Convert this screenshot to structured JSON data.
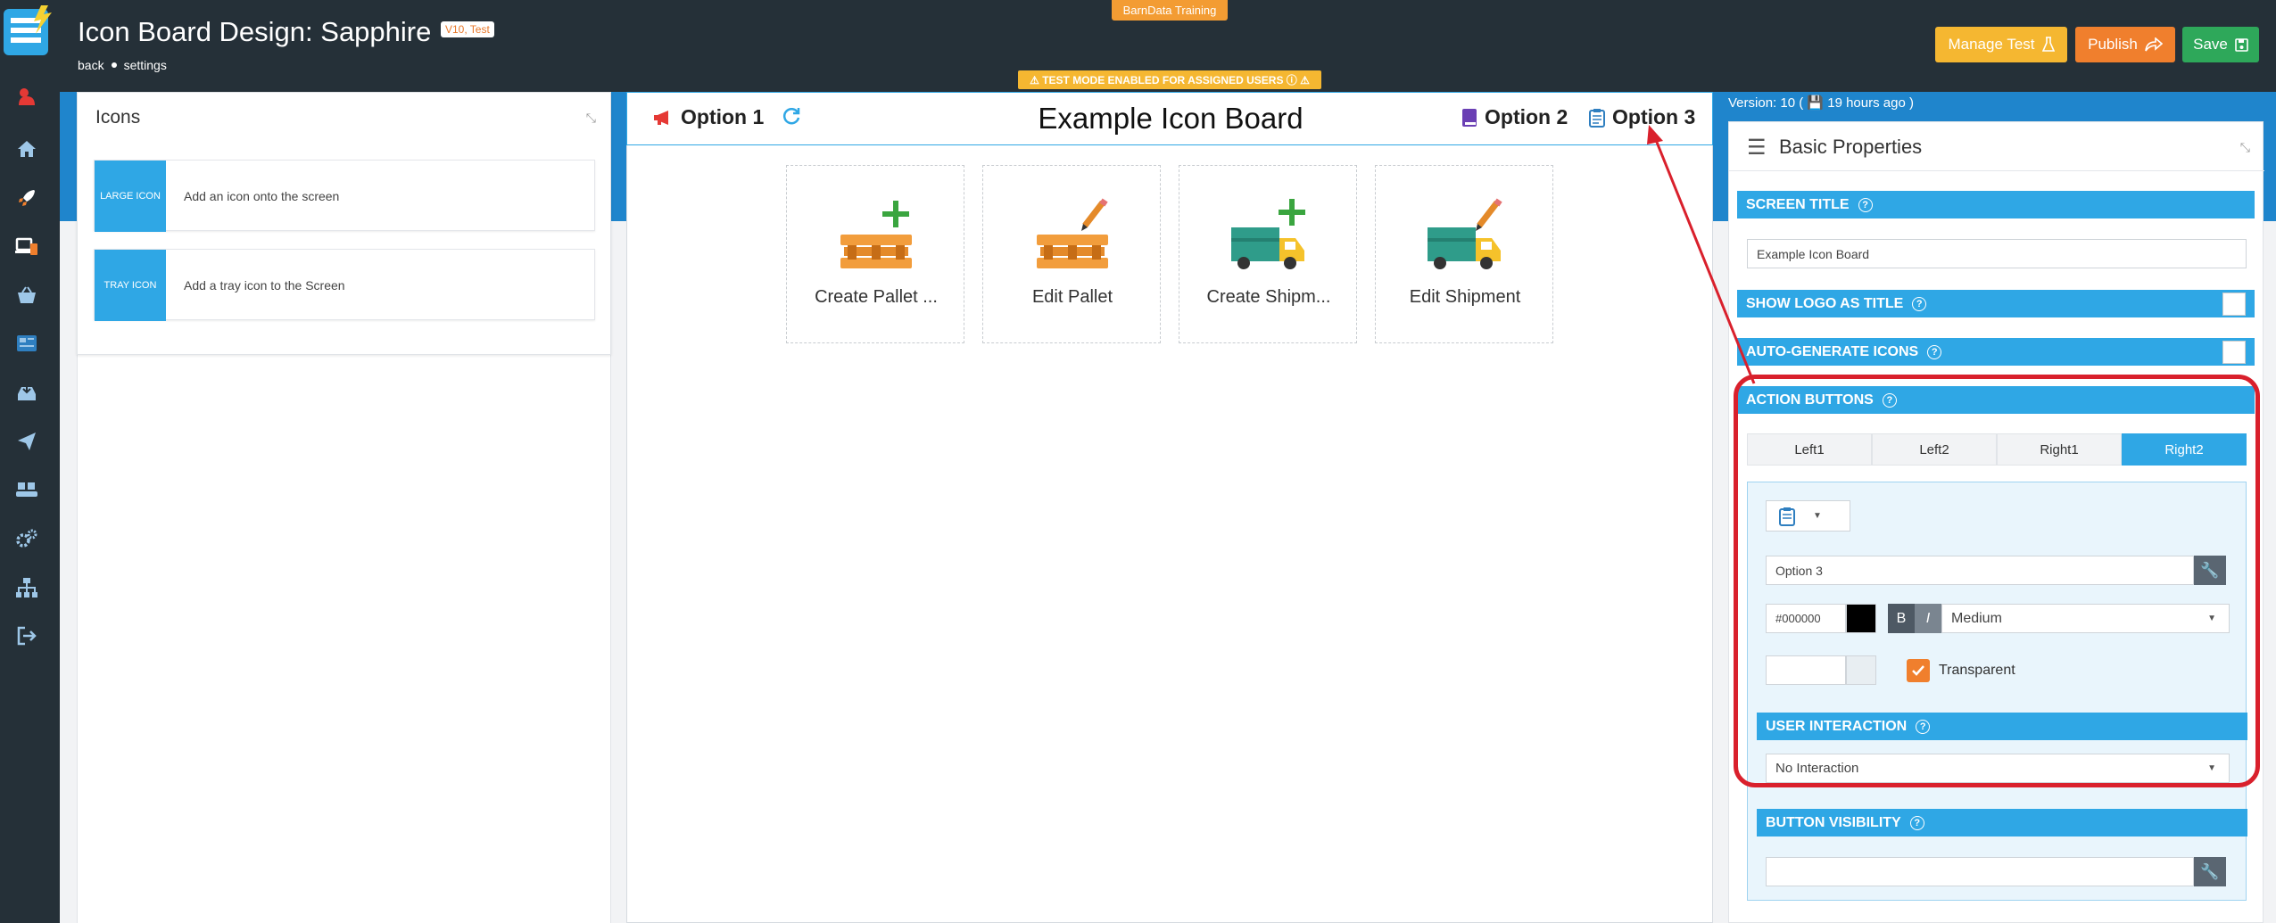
{
  "header": {
    "title": "Icon Board Design: Sapphire",
    "version_badge": "V10, Test",
    "back_link": "back",
    "settings_link": "settings",
    "org_badge": "BarnData Training",
    "test_banner": "⚠ TEST MODE ENABLED FOR ASSIGNED USERS ⓘ ⚠",
    "manage_test_label": "Manage Test",
    "publish_label": "Publish",
    "save_label": "Save"
  },
  "rail": {
    "icons": [
      "bell-icon",
      "home-icon",
      "rocket-icon",
      "devices-icon",
      "basket-icon",
      "dashboard-icon",
      "inbox-icon",
      "send-icon",
      "boxes-icon",
      "cogs-icon",
      "sitemap-icon",
      "logout-icon"
    ]
  },
  "palette": {
    "title": "Icons",
    "items": [
      {
        "swatch": "LARGE ICON",
        "description": "Add an icon onto the screen"
      },
      {
        "swatch": "TRAY ICON",
        "description": "Add a tray icon to the Screen"
      }
    ]
  },
  "board": {
    "screen_title": "Example Icon Board",
    "left_buttons": [
      {
        "label": "Option 1",
        "icon": "megaphone-icon"
      }
    ],
    "right_buttons": [
      {
        "label": "Option 2",
        "icon": "book-icon"
      },
      {
        "label": "Option 3",
        "icon": "clipboard-icon"
      }
    ],
    "tiles": [
      {
        "label": "Create Pallet ...",
        "icon": "pallet-add-icon"
      },
      {
        "label": "Edit Pallet",
        "icon": "pallet-edit-icon"
      },
      {
        "label": "Create Shipm...",
        "icon": "truck-add-icon"
      },
      {
        "label": "Edit Shipment",
        "icon": "truck-edit-icon"
      }
    ]
  },
  "properties": {
    "version_text": "Version: 10 ( 💾 19 hours ago )",
    "panel_title": "Basic Properties",
    "screen_title_label": "SCREEN TITLE",
    "screen_title_value": "Example Icon Board",
    "show_logo_label": "SHOW LOGO AS TITLE",
    "auto_generate_label": "AUTO-GENERATE ICONS",
    "action_buttons_label": "ACTION BUTTONS",
    "tabs": [
      "Left1",
      "Left2",
      "Right1",
      "Right2"
    ],
    "active_tab": "Right2",
    "button_text_value": "Option 3",
    "color_value": "#000000",
    "bold_label": "B",
    "italic_label": "I",
    "size_value": "Medium",
    "transparent_label": "Transparent",
    "user_interaction_label": "USER INTERACTION",
    "user_interaction_value": "No Interaction",
    "button_visibility_label": "BUTTON VISIBILITY"
  },
  "colors": {
    "accent": "#2fa7e5",
    "header_bg": "#253038",
    "band": "#1f85cc",
    "highlight": "#d9202c",
    "manage_test": "#f5b731",
    "publish": "#f07f2d",
    "save": "#2ea85a"
  }
}
